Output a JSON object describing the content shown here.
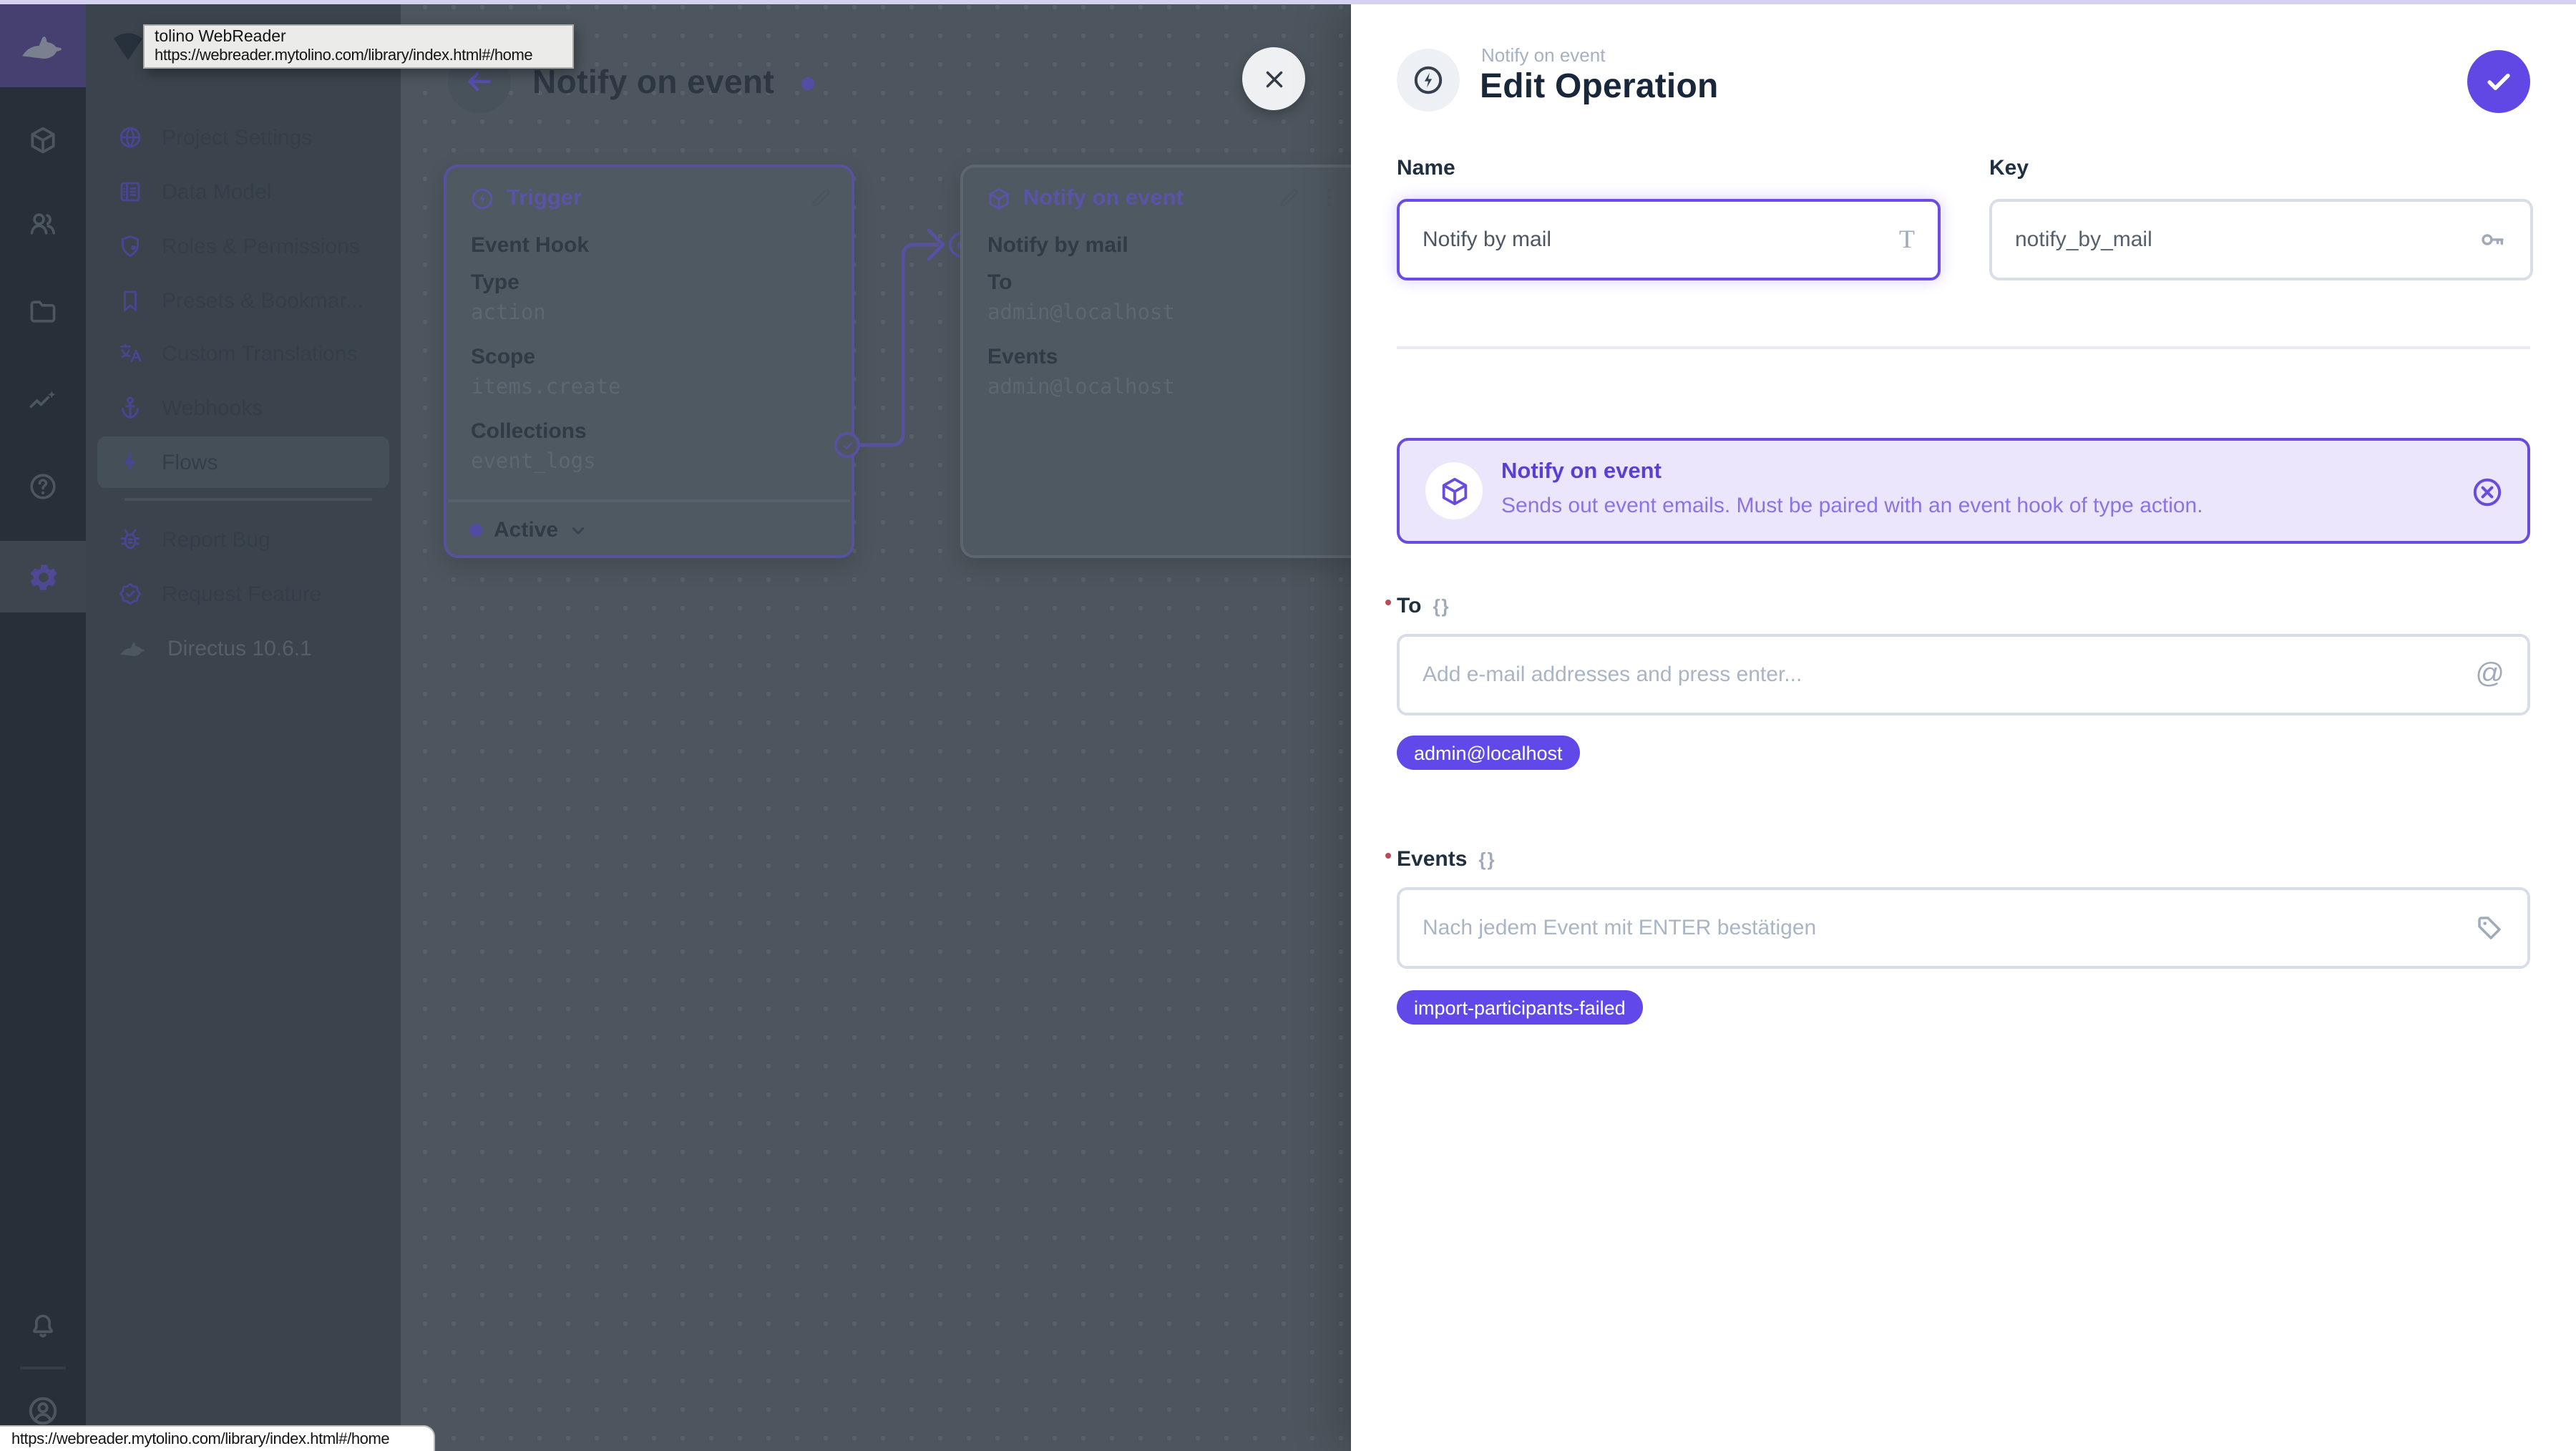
{
  "browser": {
    "drag_tooltip": {
      "title": "tolino WebReader",
      "url": "https://webreader.mytolino.com/library/index.html#/home"
    },
    "status_url": "https://webreader.mytolino.com/library/index.html#/home"
  },
  "nav": {
    "items": [
      {
        "icon": "globe-icon",
        "label": "Project Settings"
      },
      {
        "icon": "data-model-icon",
        "label": "Data Model"
      },
      {
        "icon": "shield-icon",
        "label": "Roles & Permissions"
      },
      {
        "icon": "bookmark-icon",
        "label": "Presets & Bookmar..."
      },
      {
        "icon": "translate-icon",
        "label": "Custom Translations"
      },
      {
        "icon": "anchor-icon",
        "label": "Webhooks"
      },
      {
        "icon": "zap-icon",
        "label": "Flows"
      }
    ],
    "secondary": [
      {
        "icon": "bug-icon",
        "label": "Report Bug"
      },
      {
        "icon": "rosette-check-icon",
        "label": "Request Feature"
      }
    ],
    "version": "Directus 10.6.1"
  },
  "flow": {
    "title": "Notify on event",
    "trigger_card": {
      "header": "Trigger",
      "name": "Event Hook",
      "fields": [
        {
          "label": "Type",
          "value": "action"
        },
        {
          "label": "Scope",
          "value": "items.create"
        },
        {
          "label": "Collections",
          "value": "event_logs"
        }
      ],
      "status": "Active"
    },
    "operation_card": {
      "header": "Notify on event",
      "name": "Notify by mail",
      "fields": [
        {
          "label": "To",
          "value": "admin@localhost"
        },
        {
          "label": "Events",
          "value": "admin@localhost"
        }
      ]
    }
  },
  "drawer": {
    "breadcrumb": "Notify on event",
    "title": "Edit Operation",
    "name_field": {
      "label": "Name",
      "value": "Notify by mail"
    },
    "key_field": {
      "label": "Key",
      "value": "notify_by_mail"
    },
    "notice": {
      "title": "Notify on event",
      "description": "Sends out event emails. Must be paired with an event hook of type action."
    },
    "to_field": {
      "label": "To",
      "braces": "{}",
      "placeholder": "Add e-mail addresses and press enter...",
      "chips": [
        "admin@localhost"
      ]
    },
    "events_field": {
      "label": "Events",
      "braces": "{}",
      "placeholder": "Nach jedem Event mit ENTER bestätigen",
      "chips": [
        "import-participants-failed"
      ]
    }
  },
  "colors": {
    "accent": "#6147e3",
    "chip": "#6148e8",
    "notice_border": "#6a4be0",
    "notice_bg": "#ebe6fb",
    "dimmed_connector": "#5751a0"
  }
}
